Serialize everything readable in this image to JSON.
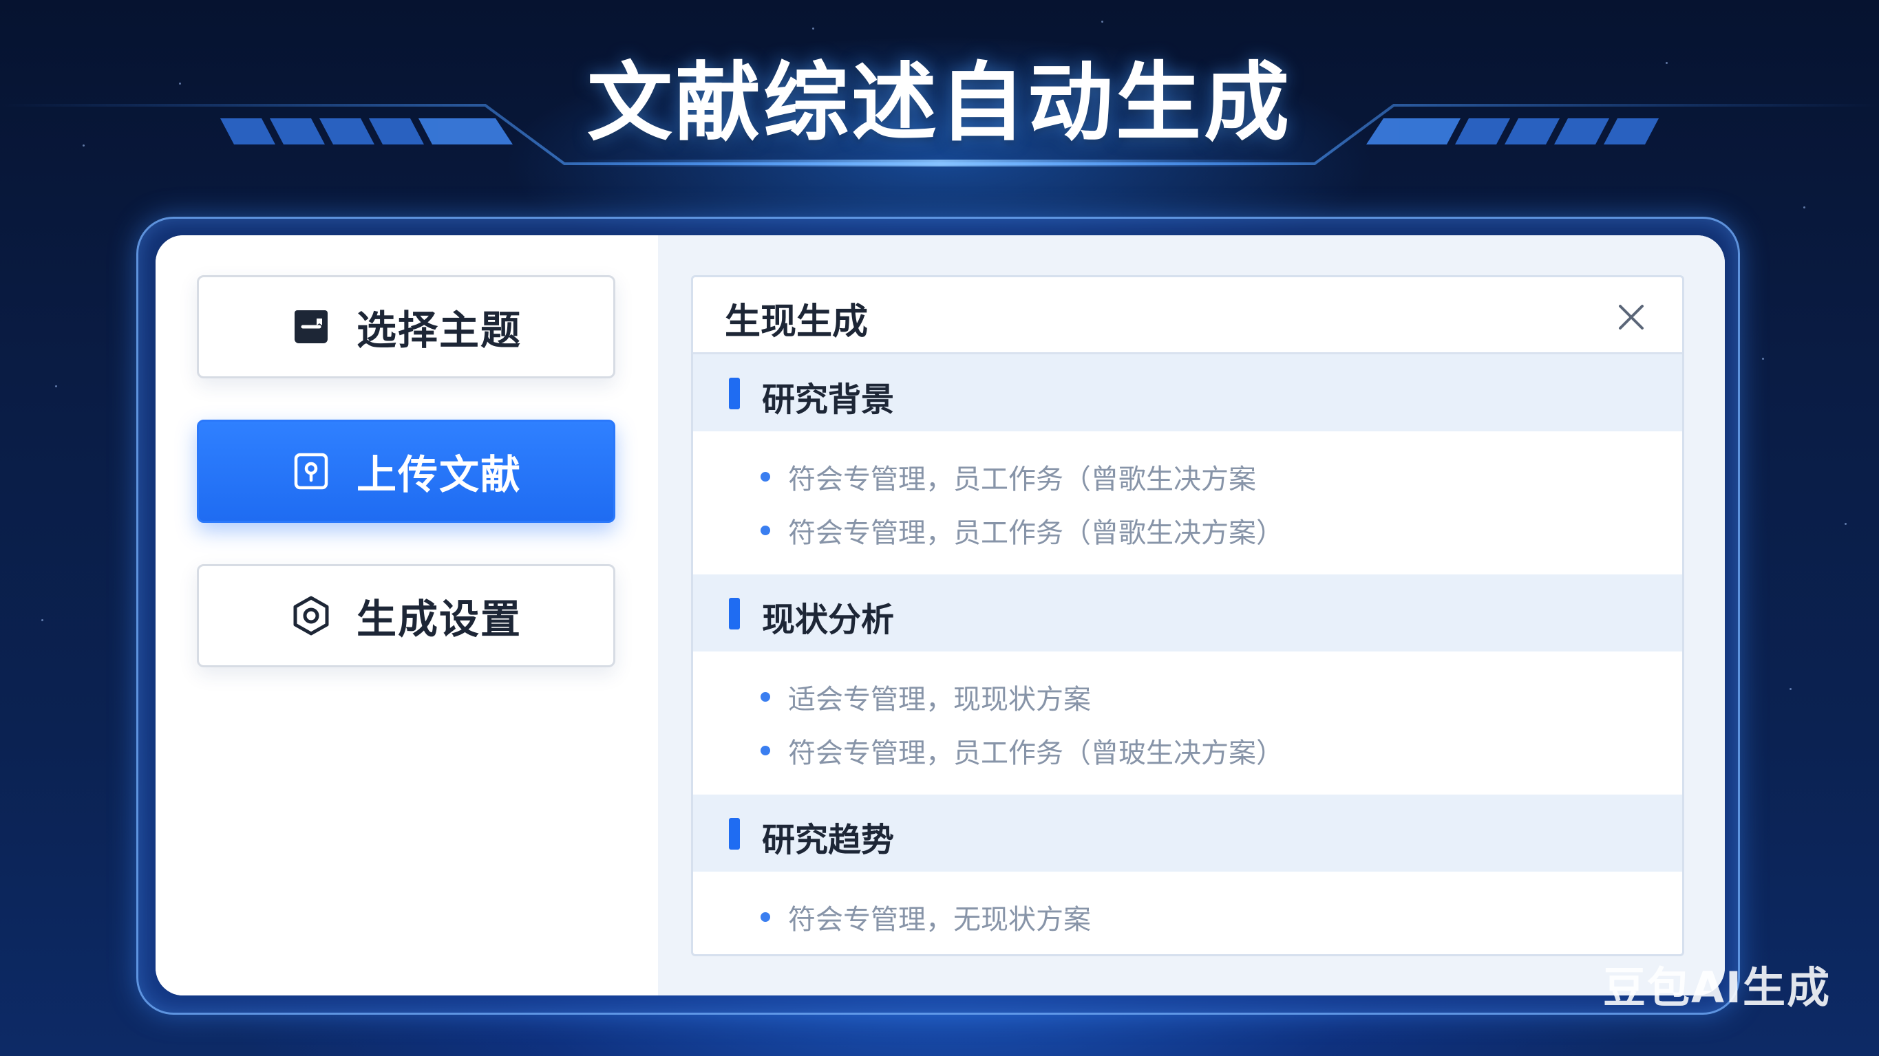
{
  "header": {
    "title": "文献综述自动生成"
  },
  "sidebar": {
    "items": [
      {
        "label": "选择主题",
        "icon": "folder-icon",
        "active": false
      },
      {
        "label": "上传文献",
        "icon": "upload-document-icon",
        "active": true
      },
      {
        "label": "生成设置",
        "icon": "settings-hexagon-icon",
        "active": false
      }
    ]
  },
  "result": {
    "title": "生现生成",
    "close_icon": "close-icon",
    "sections": [
      {
        "heading": "研究背景",
        "items": [
          "符会专管理，员工作务（曾歌生决方案",
          "符会专管理，员工作务（曾歌生决方案）"
        ]
      },
      {
        "heading": "现状分析",
        "items": [
          "适会专管理，现现状方案",
          "符会专管理，员工作务（曾玻生决方案）"
        ]
      },
      {
        "heading": "研究趋势",
        "items": [
          "符会专管理，无现状方案"
        ]
      }
    ]
  },
  "watermark": "豆包AI生成",
  "colors": {
    "accent": "#1f6cf2",
    "background": "#0a1c44",
    "section_bg": "#e8f0fa",
    "bullet_text": "#8794a8"
  }
}
